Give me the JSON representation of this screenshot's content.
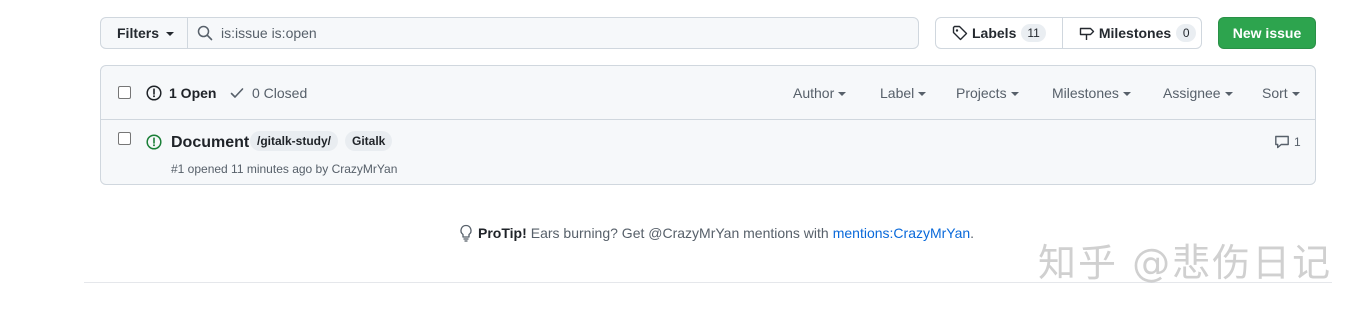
{
  "toolbar": {
    "filters_label": "Filters",
    "search_value": "is:issue is:open",
    "labels_label": "Labels",
    "labels_count": "11",
    "milestones_label": "Milestones",
    "milestones_count": "0",
    "new_issue_label": "New issue"
  },
  "header": {
    "open_label": "1 Open",
    "closed_label": "0 Closed",
    "filters": [
      "Author",
      "Label",
      "Projects",
      "Milestones",
      "Assignee",
      "Sort"
    ]
  },
  "issues": [
    {
      "title": "Document",
      "labels": [
        "/gitalk-study/",
        "Gitalk"
      ],
      "meta": "#1 opened 11 minutes ago by",
      "author": "CrazyMrYan",
      "comments": "1"
    }
  ],
  "protip": {
    "lead": "ProTip!",
    "text": "Ears burning? Get @CrazyMrYan mentions with",
    "link": "mentions:CrazyMrYan",
    "trail": "."
  },
  "watermark": "知乎 @悲伤日记",
  "colors": {
    "accent_green": "#2da44e",
    "link_blue": "#0969da",
    "open_icon_green": "#1a7f37"
  },
  "icons": [
    "search-icon",
    "tag-icon",
    "milestone-icon",
    "issue-opened-icon",
    "check-icon",
    "comment-icon",
    "light-bulb-icon"
  ]
}
